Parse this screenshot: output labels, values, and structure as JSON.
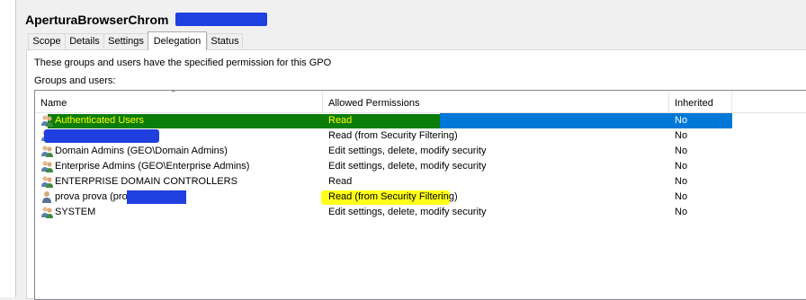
{
  "window": {
    "title": "AperturaBrowserChrom"
  },
  "tabs": [
    {
      "label": "Scope",
      "active": false
    },
    {
      "label": "Details",
      "active": false
    },
    {
      "label": "Settings",
      "active": false
    },
    {
      "label": "Delegation",
      "active": true
    },
    {
      "label": "Status",
      "active": false
    }
  ],
  "panel": {
    "description": "These groups and users have the specified permission for this GPO",
    "groups_label": "Groups and users:"
  },
  "table": {
    "columns": [
      "Name",
      "Allowed Permissions",
      "Inherited"
    ],
    "rows": [
      {
        "name": "Authenticated Users",
        "permission": "Read",
        "inherited": "No",
        "icon": "group-icon",
        "selected": true
      },
      {
        "name": "",
        "permission": "Read (from Security Filtering)",
        "inherited": "No",
        "icon": "group-icon",
        "selected": false
      },
      {
        "name": "Domain Admins (GEO\\Domain Admins)",
        "permission": "Edit settings, delete, modify security",
        "inherited": "No",
        "icon": "group-icon",
        "selected": false
      },
      {
        "name": "Enterprise Admins (GEO\\Enterprise Admins)",
        "permission": "Edit settings, delete, modify security",
        "inherited": "No",
        "icon": "group-icon",
        "selected": false
      },
      {
        "name": "ENTERPRISE DOMAIN CONTROLLERS",
        "permission": "Read",
        "inherited": "No",
        "icon": "group-icon",
        "selected": false
      },
      {
        "name": "prova prova (prov",
        "permission": "Read (from Security Filtering)",
        "inherited": "No",
        "icon": "user-icon",
        "selected": false
      },
      {
        "name": "SYSTEM",
        "permission": "Edit settings, delete, modify security",
        "inherited": "No",
        "icon": "group-icon",
        "selected": false
      }
    ]
  },
  "colors": {
    "selection": "#0078d7",
    "redaction": "#1f3fe0",
    "green_highlight": "#0a7d0a",
    "yellow_highlight": "#ffff00"
  }
}
